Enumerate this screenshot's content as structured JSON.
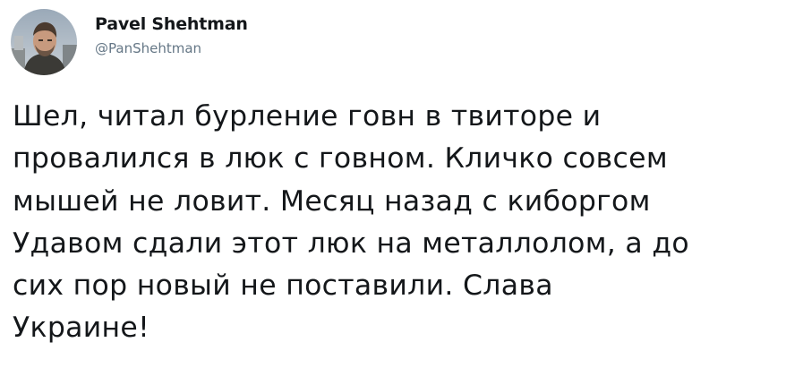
{
  "author": {
    "display_name": "Pavel Shehtman",
    "handle": "@PanShehtman",
    "avatar_icon": "user-avatar-photo"
  },
  "tweet": {
    "lines": [
      "Шел, читал бурление говн в твиторе и",
      "провалился в люк с говном. Кличко совсем",
      "мышей не ловит. Месяц назад с киборгом",
      "Удавом сдали этот люк на металлолом, а до",
      "сих пор новый не поставили. Слава",
      "Украине!"
    ]
  },
  "colors": {
    "text": "#14171a",
    "secondary": "#657786",
    "background": "#ffffff"
  }
}
